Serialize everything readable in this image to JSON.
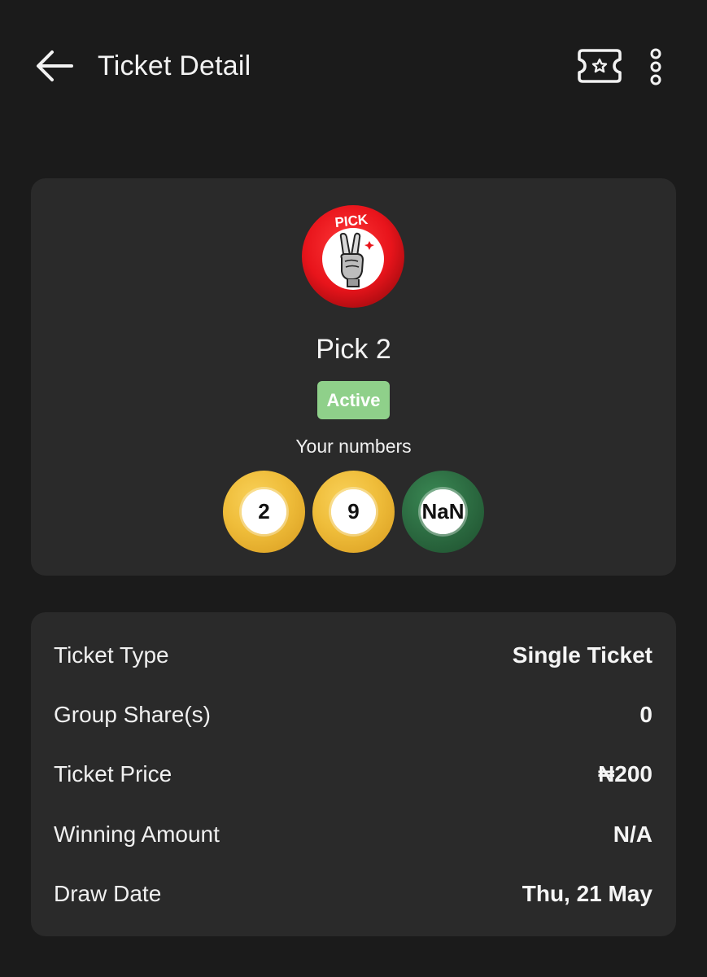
{
  "header": {
    "title": "Ticket Detail",
    "back_icon": "arrow-left-icon",
    "ticket_icon": "ticket-star-icon",
    "more_icon": "more-vertical-icon"
  },
  "game": {
    "logo_icon": "pick-peace-hand-icon",
    "logo_text": "PICK",
    "name": "Pick 2",
    "status": "Active",
    "status_color": "#8fd08a",
    "numbers_label": "Your numbers",
    "numbers": [
      {
        "value": "2",
        "color": "gold"
      },
      {
        "value": "9",
        "color": "gold"
      },
      {
        "value": "NaN",
        "color": "green"
      }
    ]
  },
  "details": [
    {
      "label": "Ticket Type",
      "value": "Single Ticket"
    },
    {
      "label": "Group Share(s)",
      "value": "0"
    },
    {
      "label": "Ticket Price",
      "value": "₦200"
    },
    {
      "label": "Winning Amount",
      "value": "N/A"
    },
    {
      "label": "Draw Date",
      "value": "Thu, 21 May"
    }
  ],
  "colors": {
    "background": "#1b1b1b",
    "card": "#2a2a2a",
    "logo_red": "#e8141b",
    "ball_gold": "#efbd3a",
    "ball_green": "#2c6b41"
  }
}
